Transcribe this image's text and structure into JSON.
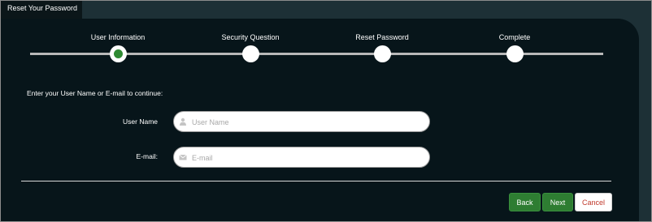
{
  "window": {
    "tab_title": "Reset Your Password"
  },
  "steps": [
    {
      "label": "User Information",
      "status": "active"
    },
    {
      "label": "Security Question",
      "status": "pending"
    },
    {
      "label": "Reset Password",
      "status": "pending"
    },
    {
      "label": "Complete",
      "status": "pending"
    }
  ],
  "form": {
    "instructions": "Enter your User Name or E-mail to continue:",
    "username": {
      "label": "User Name",
      "placeholder": "User Name",
      "value": "",
      "icon": "user-icon"
    },
    "email": {
      "label": "E-mail:",
      "placeholder": "E-mail",
      "value": "",
      "icon": "envelope-icon"
    }
  },
  "buttons": {
    "back": "Back",
    "next": "Next",
    "cancel": "Cancel"
  },
  "colors": {
    "frame_bg": "#1d3036",
    "panel_bg": "#07151a",
    "accent_green": "#2e7d32",
    "cancel_text": "#c0392b"
  }
}
